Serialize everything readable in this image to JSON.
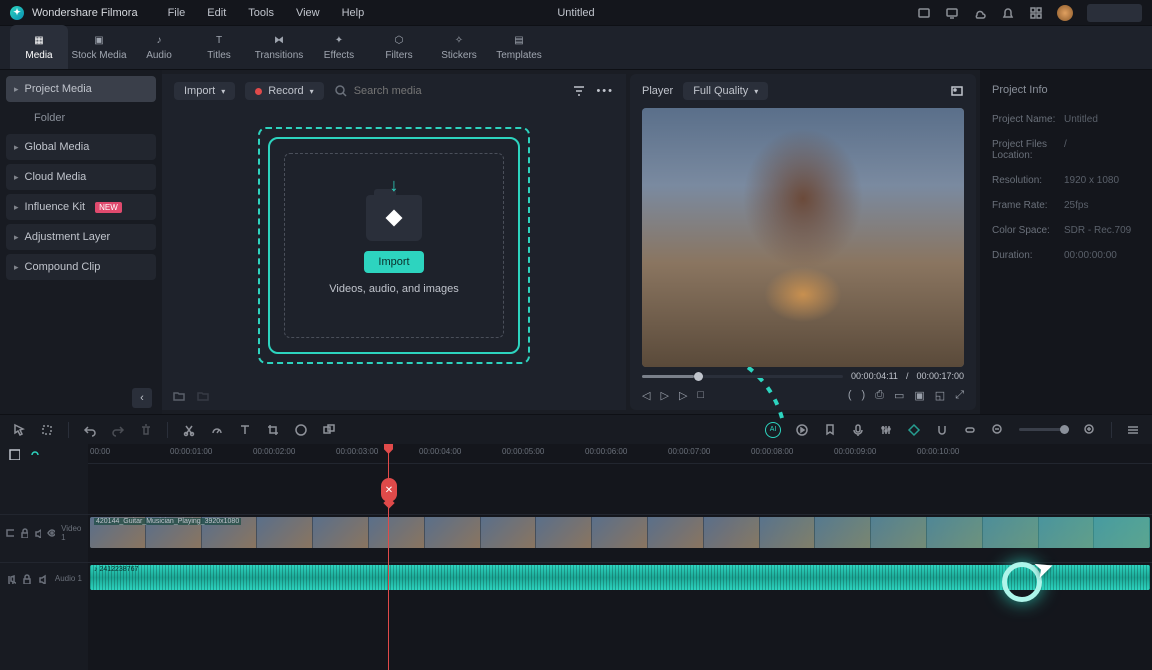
{
  "app": {
    "name": "Wondershare Filmora",
    "doc_title": "Untitled"
  },
  "menu": [
    "File",
    "Edit",
    "Tools",
    "View",
    "Help"
  ],
  "tooltabs": [
    {
      "label": "Media",
      "active": true
    },
    {
      "label": "Stock Media"
    },
    {
      "label": "Audio"
    },
    {
      "label": "Titles"
    },
    {
      "label": "Transitions"
    },
    {
      "label": "Effects"
    },
    {
      "label": "Filters"
    },
    {
      "label": "Stickers"
    },
    {
      "label": "Templates"
    }
  ],
  "sidebar": {
    "items": [
      {
        "label": "Project Media",
        "active": true
      },
      {
        "label": "Global Media"
      },
      {
        "label": "Cloud Media"
      },
      {
        "label": "Influence Kit",
        "badge": "NEW"
      },
      {
        "label": "Adjustment Layer"
      },
      {
        "label": "Compound Clip"
      }
    ],
    "folder_label": "Folder"
  },
  "media_panel": {
    "import_dd": "Import",
    "record_dd": "Record",
    "search_placeholder": "Search media",
    "import_btn": "Import",
    "drop_text": "Videos, audio, and images"
  },
  "preview": {
    "player_label": "Player",
    "quality": "Full Quality",
    "current_time": "00:00:04:11",
    "total_time": "00:00:17:00"
  },
  "info": {
    "title": "Project Info",
    "rows": [
      {
        "label": "Project Name:",
        "value": "Untitled"
      },
      {
        "label": "Project Files Location:",
        "value": "/"
      },
      {
        "label": "Resolution:",
        "value": "1920 x 1080"
      },
      {
        "label": "Frame Rate:",
        "value": "25fps"
      },
      {
        "label": "Color Space:",
        "value": "SDR - Rec.709"
      },
      {
        "label": "Duration:",
        "value": "00:00:00:00"
      }
    ]
  },
  "timeline": {
    "ruler": [
      "00:00",
      "00:00:01:00",
      "00:00:02:00",
      "00:00:03:00",
      "00:00:04:00",
      "00:00:05:00",
      "00:00:06:00",
      "00:00:07:00",
      "00:00:08:00",
      "00:00:09:00",
      "00:00:10:00"
    ],
    "video_track_label": "Video 1",
    "audio_track_label": "Audio 1",
    "vclip_label": "420144_Guitar_Musician_Playing_3920x1080",
    "aclip_label": "2412238767",
    "marker_label": "✕"
  },
  "colors": {
    "accent": "#2dd4bf",
    "bg": "#1a1d24",
    "panel": "#1e222b",
    "text": "#c0c4cc"
  }
}
